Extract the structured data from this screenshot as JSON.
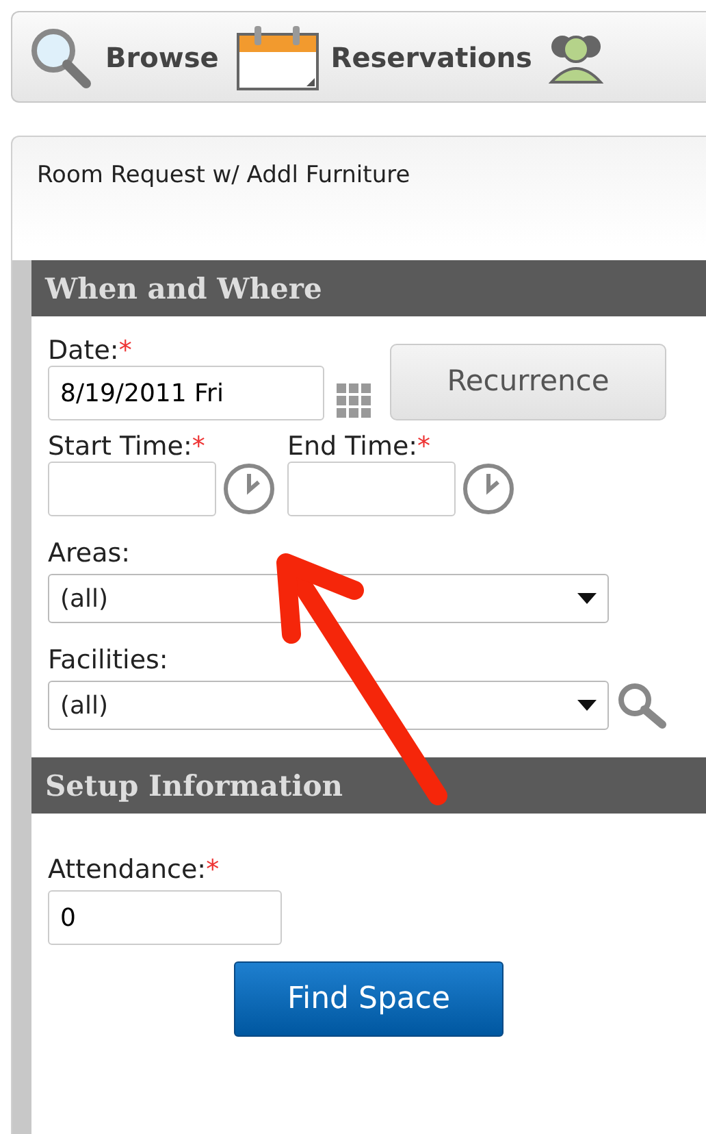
{
  "toolbar": {
    "items": [
      {
        "kind": "search",
        "label": "Browse"
      },
      {
        "kind": "calendar",
        "label": "Reservations"
      },
      {
        "kind": "people"
      }
    ]
  },
  "panel": {
    "title": "Room Request w/ Addl Furniture"
  },
  "required_mark": "*",
  "sections": [
    {
      "title": "When and Where",
      "rows": [
        {
          "kind": "date",
          "label": "Date:",
          "required": true,
          "value": "8/19/2011 Fri",
          "button": "Recurrence"
        },
        {
          "kind": "times",
          "fields": [
            {
              "label": "Start Time:",
              "required": true
            },
            {
              "label": "End Time:",
              "required": true
            }
          ]
        },
        {
          "kind": "select",
          "label": "Areas:",
          "required": false,
          "value": "(all)",
          "search": false
        },
        {
          "kind": "select",
          "label": "Facilities:",
          "required": false,
          "value": "(all)",
          "search": true
        }
      ]
    },
    {
      "title": "Setup Information",
      "rows": [
        {
          "kind": "text",
          "label": "Attendance:",
          "required": true,
          "value": "0"
        }
      ]
    }
  ],
  "submit": "Find Space"
}
